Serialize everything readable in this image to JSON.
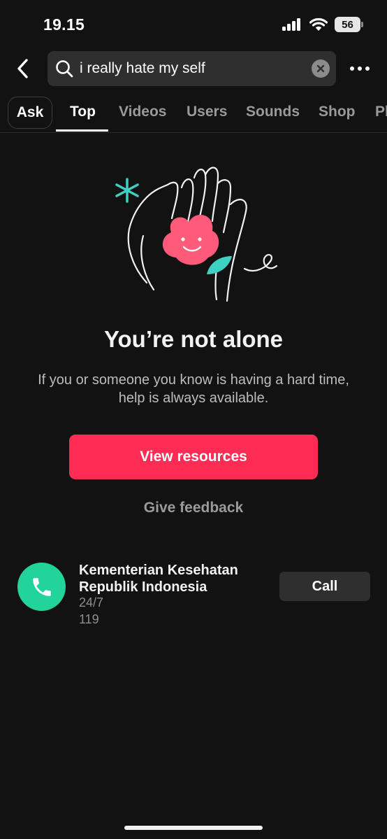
{
  "status_bar": {
    "time": "19.15",
    "battery": "56"
  },
  "header": {
    "search_value": "i really hate my self",
    "icons": {
      "back": "back-arrow-icon",
      "search": "search-icon",
      "clear": "clear-icon",
      "more": "more-icon"
    }
  },
  "tabs": {
    "ask": "Ask",
    "items": [
      "Top",
      "Videos",
      "Users",
      "Sounds",
      "Shop",
      "Pl"
    ],
    "active": "Top"
  },
  "message": {
    "headline": "You’re not alone",
    "body": "If you or someone you know is having a hard time, help is always available.",
    "primary_button": "View resources",
    "feedback_link": "Give feedback"
  },
  "hotline": {
    "name": "Kementerian Kesehatan Republik Indonesia",
    "hours": "24/7",
    "number": "119",
    "call_label": "Call"
  },
  "colors": {
    "background": "#121212",
    "accent": "#fe2c55",
    "hotline_icon": "#22d39a",
    "surface": "#2f2f2f"
  }
}
